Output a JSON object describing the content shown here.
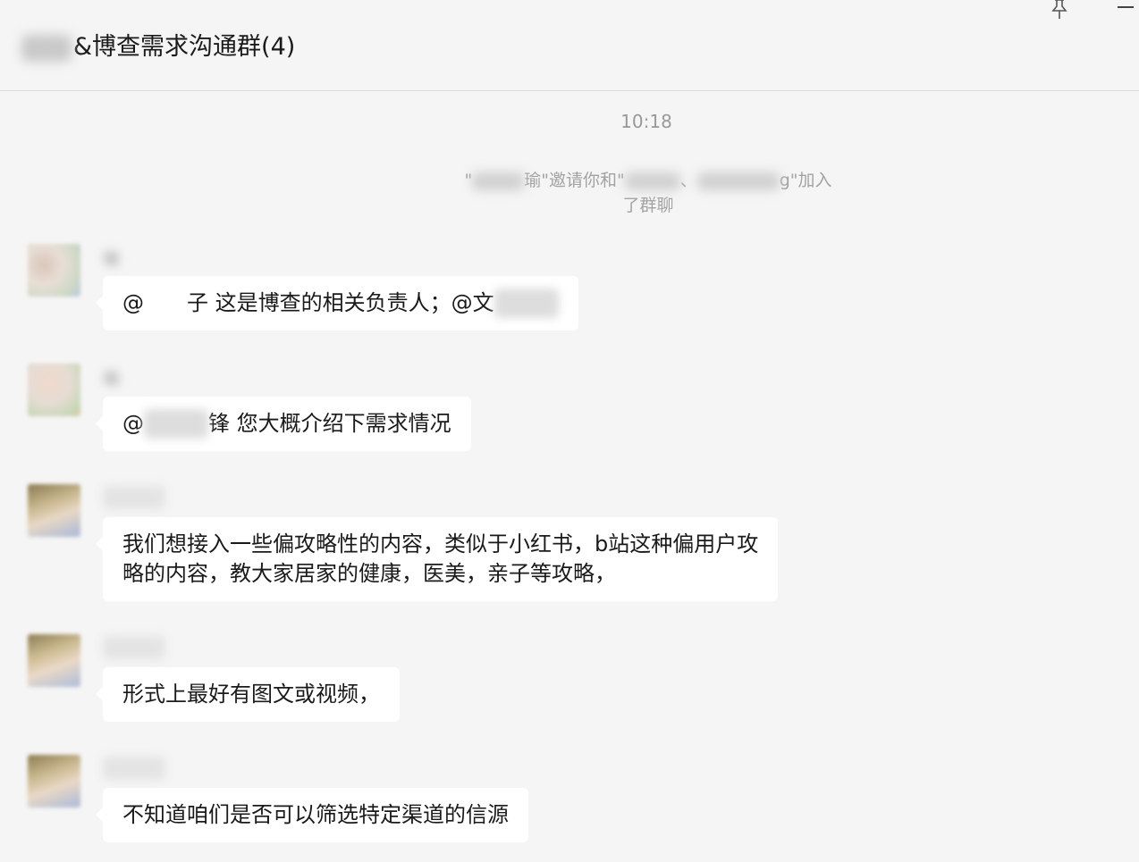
{
  "header": {
    "title_blurred_prefix": "",
    "title_visible": "&博查需求沟通群(4)"
  },
  "timestamp": "10:18",
  "system_notice": {
    "part1": "\"",
    "part2": "瑜\"邀请你和\"",
    "part3": "、",
    "part4": "g\"加入",
    "line2": "了群聊"
  },
  "messages": [
    {
      "sender_visible": "瑜",
      "text_prefix": "@",
      "mention1_tail": "子",
      "text_middle": " 这是博查的相关负责人；@",
      "mention2_head": "文",
      "text_suffix": ""
    },
    {
      "sender_visible": "瑜",
      "text_prefix": "@",
      "mention1_tail": "锋",
      "text_middle": " 您大概介绍下需求情况"
    },
    {
      "line1": "我们想接入一些偏攻略性的内容，类似于小红书，b站这种偏用户攻",
      "line2": "略的内容，教大家居家的健康，医美，亲子等攻略，"
    },
    {
      "text": "形式上最好有图文或视频，"
    },
    {
      "text": "不知道咱们是否可以筛选特定渠道的信源"
    }
  ],
  "colors": {
    "background": "#f5f5f5",
    "bubble": "#ffffff",
    "text": "#1a1a1a",
    "muted": "#999999"
  }
}
